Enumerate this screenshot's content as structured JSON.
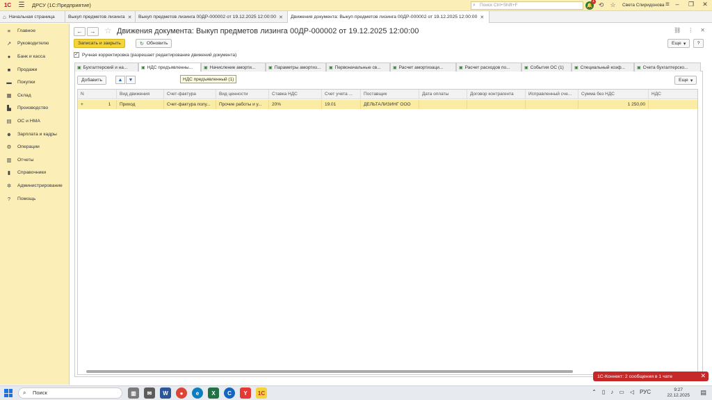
{
  "app": {
    "title": "ДРСУ  (1С:Предприятие)",
    "search_placeholder": "Поиск Ctrl+Shift+F",
    "user": "Света Спиридонова",
    "notif_count": "1"
  },
  "open_tabs": [
    {
      "label": "Начальная страница"
    },
    {
      "label": "Выкуп предметов лизинга"
    },
    {
      "label": "Выкуп предметов лизинга 00ДР-000002 от 19.12.2025 12:00:00"
    },
    {
      "label": "Движения документа: Выкуп предметов лизинга 00ДР-000002 от 19.12.2025 12:00:00"
    }
  ],
  "sidebar": {
    "items": [
      {
        "label": "Главное",
        "icon": "menu-icon"
      },
      {
        "label": "Руководителю",
        "icon": "chart-icon"
      },
      {
        "label": "Банк и касса",
        "icon": "bank-icon"
      },
      {
        "label": "Продажи",
        "icon": "bag-icon"
      },
      {
        "label": "Покупки",
        "icon": "cart-icon"
      },
      {
        "label": "Склад",
        "icon": "box-icon"
      },
      {
        "label": "Производство",
        "icon": "factory-icon"
      },
      {
        "label": "ОС и НМА",
        "icon": "assets-icon"
      },
      {
        "label": "Зарплата и кадры",
        "icon": "people-icon"
      },
      {
        "label": "Операции",
        "icon": "ops-icon"
      },
      {
        "label": "Отчеты",
        "icon": "report-icon"
      },
      {
        "label": "Справочники",
        "icon": "book-icon"
      },
      {
        "label": "Администрирование",
        "icon": "gear-icon"
      },
      {
        "label": "Помощь",
        "icon": "help-icon"
      }
    ]
  },
  "form": {
    "title": "Движения документа: Выкуп предметов лизинга 00ДР-000002 от 19.12.2025 12:00:00",
    "save_close": "Записать и закрыть",
    "refresh": "Обновить",
    "more": "Еще",
    "help": "?",
    "manual_adjust": "Ручная корректировка (разрешает редактирование движений документа)"
  },
  "doc_tabs": [
    {
      "label": "Бухгалтерский и на..."
    },
    {
      "label": "НДС предъявленны..."
    },
    {
      "label": "Начисление аморти..."
    },
    {
      "label": "Параметры амортиз..."
    },
    {
      "label": "Первоначальные св..."
    },
    {
      "label": "Расчет амортизаци..."
    },
    {
      "label": "Расчет расходов по..."
    },
    {
      "label": "События ОС (1)"
    },
    {
      "label": "Специальный коэф..."
    },
    {
      "label": "Счета бухгалтерско..."
    }
  ],
  "panel": {
    "add": "Добавить",
    "more": "Еще",
    "tooltip": "НДС предъявленный (1)"
  },
  "table": {
    "headers": [
      "N",
      "Вид движения",
      "Счет-фактура",
      "Вид ценности",
      "Ставка НДС",
      "Счет учета ...",
      "Поставщик",
      "Дата оплаты",
      "Договор контрагента",
      "Исправленный сче...",
      "Сумма без НДС",
      "НДС"
    ],
    "rows": [
      [
        "1",
        "Приход",
        "Счет-фактура полу...",
        "Прочие работы и у...",
        "20%",
        "19.01",
        "ДЕЛЬТАЛИЗИНГ ООО",
        "",
        "",
        "",
        "1 250,00",
        ""
      ]
    ]
  },
  "notification": {
    "text": "1С-Коннект: 2 сообщения в 1 чате"
  },
  "taskbar": {
    "search": "Поиск",
    "lang": "РУС",
    "time": "9:27",
    "date": "22.12.2025"
  }
}
